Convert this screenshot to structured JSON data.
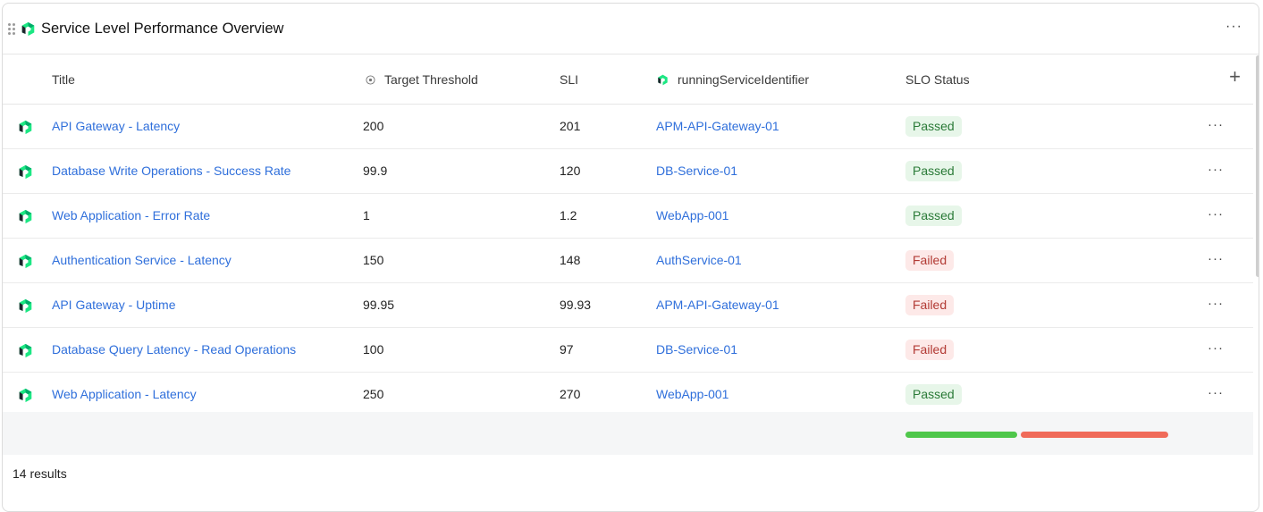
{
  "widget": {
    "title": "Service Level Performance Overview"
  },
  "table": {
    "columns": [
      {
        "key": "title",
        "label": "Title"
      },
      {
        "key": "target",
        "label": "Target Threshold",
        "icon": "target-icon"
      },
      {
        "key": "sli",
        "label": "SLI"
      },
      {
        "key": "service",
        "label": "runningServiceIdentifier",
        "icon": "service-entity-icon"
      },
      {
        "key": "status",
        "label": "SLO Status"
      }
    ],
    "add_column_label": "+",
    "rows": [
      {
        "title": "API Gateway - Latency",
        "target": "200",
        "sli": "201",
        "service": "APM-API-Gateway-01",
        "status": "Passed"
      },
      {
        "title": "Database Write Operations - Success Rate",
        "target": "99.9",
        "sli": "120",
        "service": "DB-Service-01",
        "status": "Passed"
      },
      {
        "title": "Web Application - Error Rate",
        "target": "1",
        "sli": "1.2",
        "service": "WebApp-001",
        "status": "Passed"
      },
      {
        "title": "Authentication Service - Latency",
        "target": "150",
        "sli": "148",
        "service": "AuthService-01",
        "status": "Failed"
      },
      {
        "title": "API Gateway - Uptime",
        "target": "99.95",
        "sli": "99.93",
        "service": "APM-API-Gateway-01",
        "status": "Failed"
      },
      {
        "title": "Database Query Latency - Read Operations",
        "target": "100",
        "sli": "97",
        "service": "DB-Service-01",
        "status": "Failed"
      },
      {
        "title": "Web Application - Latency",
        "target": "250",
        "sli": "270",
        "service": "WebApp-001",
        "status": "Passed"
      }
    ],
    "row_menu_label": "···"
  },
  "summary": {
    "status_distribution": {
      "passed_fraction": 0.43,
      "failed_fraction": 0.57
    },
    "colors": {
      "passed": "#4fc74b",
      "failed": "#f06b5a"
    }
  },
  "footer": {
    "results": "14 results"
  },
  "colors": {
    "link": "#2f6fdb",
    "brand": "#00a97a",
    "passed_badge_bg": "#e7f6e9",
    "failed_badge_bg": "#fde9e8"
  }
}
